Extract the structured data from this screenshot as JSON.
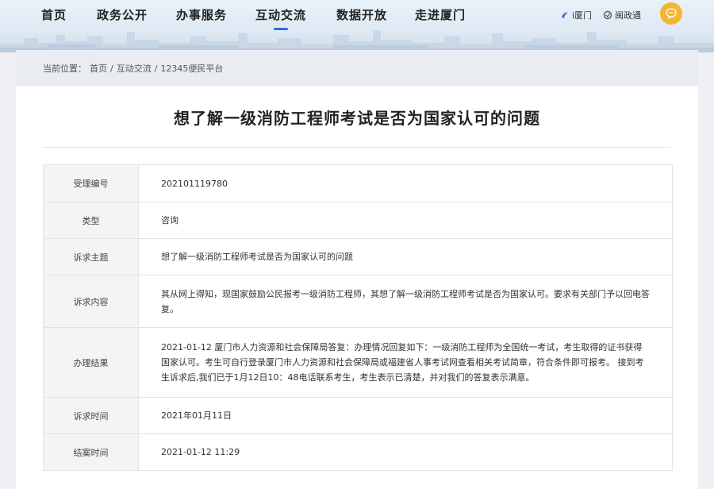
{
  "nav": {
    "items": [
      "首页",
      "政务公开",
      "办事服务",
      "互动交流",
      "数据开放",
      "走进厦门"
    ],
    "active_index": 3,
    "quick_links": [
      "i厦门",
      "闽政通"
    ]
  },
  "breadcrumb": {
    "prefix": "当前位置：",
    "items": [
      "首页",
      "/",
      "互动交流",
      "/",
      "12345便民平台"
    ]
  },
  "title": "想了解一级消防工程师考试是否为国家认可的问题",
  "rows": [
    {
      "label": "受理编号",
      "value": "202101119780"
    },
    {
      "label": "类型",
      "value": "咨询"
    },
    {
      "label": "诉求主题",
      "value": "想了解一级消防工程师考试是否为国家认可的问题"
    },
    {
      "label": "诉求内容",
      "value": "其从网上得知，现国家鼓励公民报考一级消防工程师，其想了解一级消防工程师考试是否为国家认可。要求有关部门予以回电答复。"
    },
    {
      "label": "办理结果",
      "value": "2021-01-12 厦门市人力资源和社会保障局答复：办理情况回复如下：一级消防工程师为全国统一考试，考生取得的证书获得国家认可。考生可自行登录厦门市人力资源和社会保障局或福建省人事考试网查看相关考试简章，符合条件即可报考。 接到考生诉求后,我们已于1月12日10：48电话联系考生，考生表示已清楚，并对我们的答复表示满意。"
    },
    {
      "label": "诉求时间",
      "value": "2021年01月11日"
    },
    {
      "label": "结案时间",
      "value": "2021-01-12 11:29"
    }
  ],
  "colors": {
    "accent": "#2a6fd6",
    "avatar": "#f5b52e",
    "label_bg": "#f3f4f6"
  }
}
